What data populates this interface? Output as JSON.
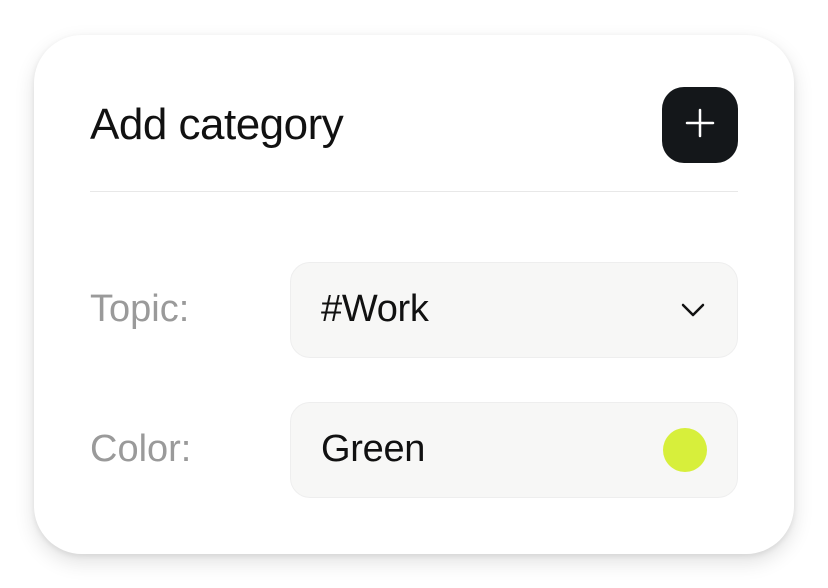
{
  "header": {
    "title": "Add category"
  },
  "form": {
    "topic": {
      "label": "Topic:",
      "value": "#Work"
    },
    "color": {
      "label": "Color:",
      "value": "Green",
      "swatch": "#d7ef3b"
    }
  }
}
